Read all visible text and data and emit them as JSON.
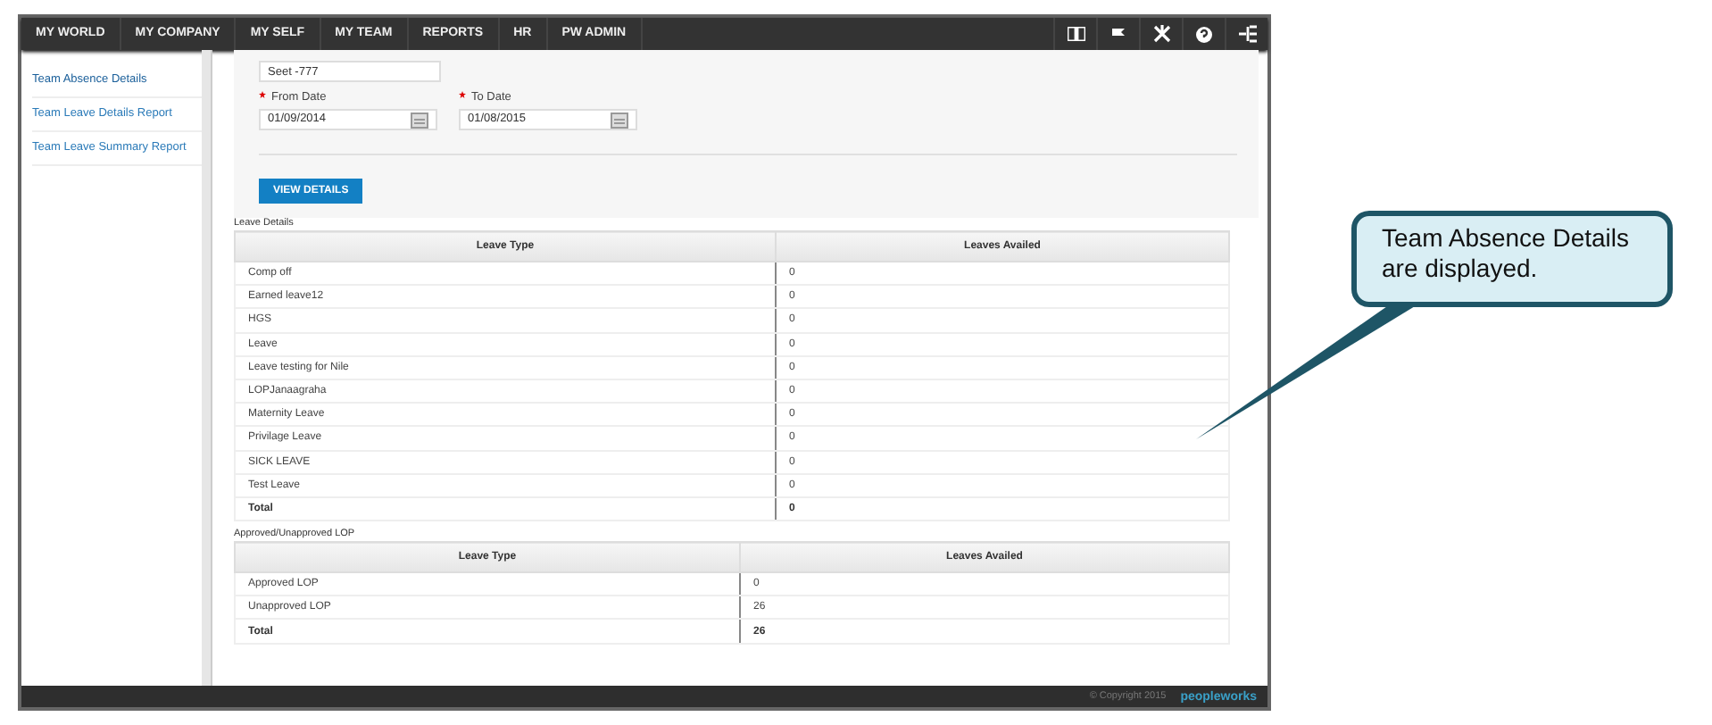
{
  "nav": {
    "items": [
      "MY WORLD",
      "MY COMPANY",
      "MY SELF",
      "MY TEAM",
      "REPORTS",
      "HR",
      "PW ADMIN"
    ],
    "icons": [
      {
        "kind": "book"
      },
      {
        "kind": "flag"
      },
      {
        "kind": "tools"
      },
      {
        "kind": "help"
      },
      {
        "kind": "sitemap"
      }
    ]
  },
  "sidebar": {
    "items": [
      {
        "label": "Team Absence Details",
        "selected": true
      },
      {
        "label": "Team Leave Details Report",
        "selected": false
      },
      {
        "label": "Team Leave Summary Report",
        "selected": false
      }
    ]
  },
  "form": {
    "employee": "Seet -777",
    "dates": [
      {
        "label": "From Date",
        "value": "01/09/2014",
        "required": true
      },
      {
        "label": "To Date",
        "value": "01/08/2015",
        "required": true
      }
    ],
    "button": "VIEW DETAILS"
  },
  "tables": [
    {
      "title": "Leave Details",
      "columns": [
        "Leave Type",
        "Leaves Availed"
      ],
      "rows": [
        {
          "cells": [
            "Comp off",
            "0"
          ],
          "total": false
        },
        {
          "cells": [
            "Earned leave12",
            "0"
          ],
          "total": false
        },
        {
          "cells": [
            "HGS",
            "0"
          ],
          "total": false
        },
        {
          "cells": [
            "Leave",
            "0"
          ],
          "total": false
        },
        {
          "cells": [
            "Leave testing for Nile",
            "0"
          ],
          "total": false
        },
        {
          "cells": [
            "LOPJanaagraha",
            "0"
          ],
          "total": false
        },
        {
          "cells": [
            "Maternity Leave",
            "0"
          ],
          "total": false
        },
        {
          "cells": [
            "Privilage Leave",
            "0"
          ],
          "total": false
        },
        {
          "cells": [
            "SICK LEAVE",
            "0"
          ],
          "total": false
        },
        {
          "cells": [
            "Test Leave",
            "0"
          ],
          "total": false
        },
        {
          "cells": [
            "Total",
            "0"
          ],
          "total": true
        }
      ]
    },
    {
      "title": "Approved/Unapproved LOP",
      "columns": [
        "Leave Type",
        "Leaves Availed"
      ],
      "rows": [
        {
          "cells": [
            "Approved LOP",
            "0"
          ],
          "total": false
        },
        {
          "cells": [
            "Unapproved LOP",
            "26"
          ],
          "total": false
        },
        {
          "cells": [
            "Total",
            "26"
          ],
          "total": true
        }
      ]
    }
  ],
  "footer": {
    "copyright": "© Copyright 2015",
    "logo": "peopleworks"
  },
  "callout": {
    "text": "Team Absence Details are displayed."
  }
}
